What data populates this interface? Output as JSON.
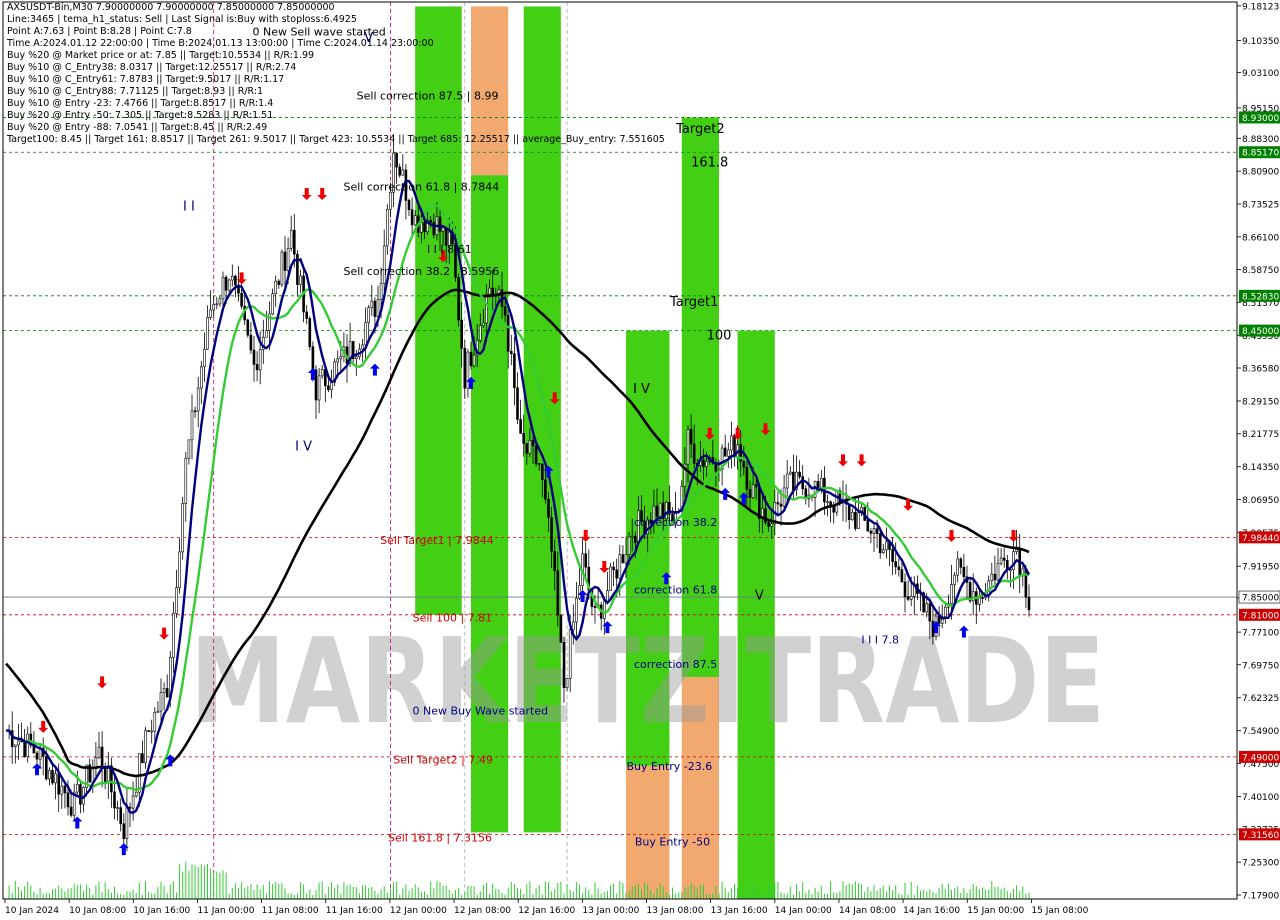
{
  "info": {
    "lines": [
      "AXSUSDT-Bin,M30  7.90000000 7.90000000 7.85000000 7.85000000",
      "Line:3465 | tema_h1_status: Sell | Last Signal is:Buy with stoploss:6.4925",
      "Point A:7.63 | Point B:8.28 | Point C:7.8",
      "Time A:2024.01.12 22:00:00 | Time B:2024.01.13 13:00:00 | Time C:2024.01.14 23:00:00",
      "Buy %20 @ Market price or at: 7.85 || Target:10.5534 || R/R:1.99",
      "Buy %10 @ C_Entry38: 8.0317 || Target:12.25517 || R/R:2.74",
      "Buy %10 @ C_Entry61: 7.8783 || Target:9.5017 || R/R:1.17",
      "Buy %10 @ C_Entry88: 7.71125 || Target:8.93 || R/R:1",
      "Buy %10 @ Entry -23: 7.4766 || Target:8.8517 || R/R:1.4",
      "Buy %20 @ Entry -50: 7.305 || Target:8.5283 || R/R:1.51",
      "Buy %20 @ Entry -88: 7.0541 || Target:8.45 || R/R:2.49",
      "Target100: 8.45 || Target 161: 8.8517 || Target 261: 9.5017 || Target 423: 10.5534 || Target 685: 12.25517 || average_Buy_entry: 7.551605"
    ]
  },
  "colors": {
    "green_zone": "#33cc00",
    "orange_zone": "#f0a060",
    "candle": "#000000",
    "ma_black": "#000000",
    "ma_navy": "#000080",
    "ma_green": "#33cc33",
    "buy_arrow": "#0000ee",
    "sell_arrow": "#ee0000",
    "level_green": "#008000",
    "level_red": "#cc0000",
    "current_price": "#000000"
  },
  "watermark": "MARKETZITRADE",
  "chart_data": {
    "type": "candlestick",
    "symbol": "AXSUSDT-Bin",
    "timeframe": "M30",
    "ylim": [
      7.17,
      9.19
    ],
    "y_ticks": [
      "9.18123",
      "9.10350",
      "9.03100",
      "8.95150",
      "8.88300",
      "8.80900",
      "8.73525",
      "8.66100",
      "8.58750",
      "8.51370",
      "8.43950",
      "8.36580",
      "8.29150",
      "8.21775",
      "8.14350",
      "8.06950",
      "7.99575",
      "7.91950",
      "7.84800",
      "7.77100",
      "7.69750",
      "7.62325",
      "7.54900",
      "7.47500",
      "7.40100",
      "7.32725",
      "7.25300",
      "7.17900"
    ],
    "x_ticks": [
      "10 Jan 2024",
      "10 Jan 08:00",
      "10 Jan 16:00",
      "11 Jan 00:00",
      "11 Jan 08:00",
      "11 Jan 16:00",
      "12 Jan 00:00",
      "12 Jan 08:00",
      "12 Jan 16:00",
      "13 Jan 00:00",
      "13 Jan 08:00",
      "13 Jan 16:00",
      "14 Jan 00:00",
      "14 Jan 08:00",
      "14 Jan 16:00",
      "15 Jan 00:00",
      "15 Jan 08:00"
    ],
    "price_levels": [
      {
        "price": 8.93,
        "label": "8.93000",
        "kind": "green"
      },
      {
        "price": 8.8517,
        "label": "8.85170",
        "kind": "green"
      },
      {
        "price": 8.5283,
        "label": "8.52830",
        "kind": "green"
      },
      {
        "price": 8.45,
        "label": "8.45000",
        "kind": "green"
      },
      {
        "price": 7.9844,
        "label": "7.98440",
        "kind": "red"
      },
      {
        "price": 7.85,
        "label": "7.85000",
        "kind": "current"
      },
      {
        "price": 7.81,
        "label": "7.81000",
        "kind": "red"
      },
      {
        "price": 7.49,
        "label": "7.49000",
        "kind": "red"
      },
      {
        "price": 7.3156,
        "label": "7.31560",
        "kind": "red"
      }
    ],
    "zones": [
      {
        "bar_from": 132,
        "bar_to": 147,
        "top": 9.18,
        "bottom": 7.81,
        "color": "green"
      },
      {
        "bar_from": 150,
        "bar_to": 162,
        "top": 9.18,
        "bottom": 8.8,
        "color": "orange"
      },
      {
        "bar_from": 150,
        "bar_to": 162,
        "top": 8.8,
        "bottom": 7.75,
        "color": "green"
      },
      {
        "bar_from": 150,
        "bar_to": 162,
        "top": 7.75,
        "bottom": 7.32,
        "color": "green"
      },
      {
        "bar_from": 167,
        "bar_to": 179,
        "top": 9.18,
        "bottom": 7.32,
        "color": "green"
      },
      {
        "bar_from": 200,
        "bar_to": 214,
        "top": 8.45,
        "bottom": 7.47,
        "color": "green"
      },
      {
        "bar_from": 200,
        "bar_to": 214,
        "top": 7.47,
        "bottom": 7.17,
        "color": "orange"
      },
      {
        "bar_from": 218,
        "bar_to": 230,
        "top": 8.93,
        "bottom": 7.67,
        "color": "green"
      },
      {
        "bar_from": 218,
        "bar_to": 230,
        "top": 7.67,
        "bottom": 7.17,
        "color": "orange"
      },
      {
        "bar_from": 236,
        "bar_to": 248,
        "top": 8.45,
        "bottom": 7.17,
        "color": "green"
      }
    ],
    "annotations": [
      {
        "text": "0 New Sell wave started",
        "bar": 101,
        "price": 9.115,
        "color": "#000000"
      },
      {
        "text": "Sell correction 87.5 | 8.99",
        "bar": 136,
        "price": 8.97,
        "color": "#000000"
      },
      {
        "text": "Sell correction 61.8 | 8.7844",
        "bar": 134,
        "price": 8.765,
        "color": "#000000"
      },
      {
        "text": "Sell correction 38.2 | 8.5956",
        "bar": 134,
        "price": 8.575,
        "color": "#000000"
      },
      {
        "text": "I I I 8.61",
        "bar": 143,
        "price": 8.625,
        "color": "#000000"
      },
      {
        "text": "Target2",
        "bar": 224,
        "price": 8.895,
        "color": "#000000"
      },
      {
        "text": "161.8",
        "bar": 227,
        "price": 8.82,
        "color": "#000000"
      },
      {
        "text": "Target1",
        "bar": 222,
        "price": 8.505,
        "color": "#000000"
      },
      {
        "text": "100",
        "bar": 230,
        "price": 8.43,
        "color": "#000000"
      },
      {
        "text": "I V",
        "bar": 205,
        "price": 8.31,
        "color": "#000000"
      },
      {
        "text": "I V",
        "bar": 96,
        "price": 8.18,
        "color": "#000080"
      },
      {
        "text": "I I",
        "bar": 59,
        "price": 8.72,
        "color": "#000080"
      },
      {
        "text": "correction 38.2",
        "bar": 216,
        "price": 8.01,
        "color": "#000080"
      },
      {
        "text": "correction 61.8",
        "bar": 216,
        "price": 7.858,
        "color": "#000080"
      },
      {
        "text": "correction 87.5",
        "bar": 216,
        "price": 7.69,
        "color": "#000080"
      },
      {
        "text": "0 New Buy Wave started",
        "bar": 153,
        "price": 7.585,
        "color": "#000080"
      },
      {
        "text": "Buy Entry -23.6",
        "bar": 214,
        "price": 7.46,
        "color": "#000080"
      },
      {
        "text": "Buy Entry -50",
        "bar": 215,
        "price": 7.29,
        "color": "#000080"
      },
      {
        "text": "Sell Target1 | 7.9844",
        "bar": 139,
        "price": 7.97,
        "color": "#cc0000"
      },
      {
        "text": "Sell 100 | 7.81",
        "bar": 144,
        "price": 7.795,
        "color": "#cc0000"
      },
      {
        "text": "Sell Target2 | 7.49",
        "bar": 141,
        "price": 7.475,
        "color": "#cc0000"
      },
      {
        "text": "Sell 161.8 | 7.3156",
        "bar": 140,
        "price": 7.3,
        "color": "#cc0000"
      },
      {
        "text": "V",
        "bar": 243,
        "price": 7.845,
        "color": "#000000"
      },
      {
        "text": "I I I 7.8",
        "bar": 282,
        "price": 7.745,
        "color": "#000080"
      },
      {
        "text": "V",
        "bar": 117,
        "price": 9.1,
        "color": "#000080"
      }
    ]
  }
}
